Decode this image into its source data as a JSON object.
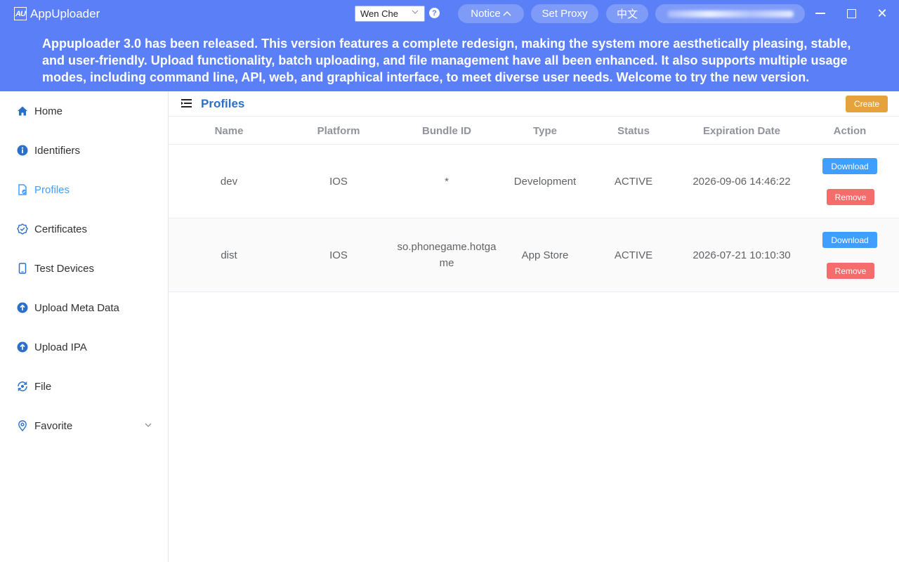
{
  "app": {
    "logo_text": "AU",
    "title": "AppUploader"
  },
  "toolbar": {
    "account": "Wen Che",
    "help": "?",
    "notice": "Notice",
    "set_proxy": "Set Proxy",
    "language": "中文",
    "close_glyph": "✕"
  },
  "announcement": "Appuploader 3.0 has been released. This version features a complete redesign, making the system more aesthetically pleasing, stable, and user-friendly. Upload functionality, batch uploading, and file management have all been enhanced. It also supports multiple usage modes, including command line, API, web, and graphical interface, to meet diverse user needs. Welcome to try the new version.",
  "sidebar": {
    "active": "Profiles",
    "items": [
      {
        "label": "Home",
        "icon": "home-icon"
      },
      {
        "label": "Identifiers",
        "icon": "info-icon"
      },
      {
        "label": "Profiles",
        "icon": "profile-file-icon"
      },
      {
        "label": "Certificates",
        "icon": "certificate-badge-icon"
      },
      {
        "label": "Test Devices",
        "icon": "phone-icon"
      },
      {
        "label": "Upload Meta Data",
        "icon": "upload-circle-icon"
      },
      {
        "label": "Upload IPA",
        "icon": "upload-circle-icon"
      },
      {
        "label": "File",
        "icon": "file-sync-icon"
      },
      {
        "label": "Favorite",
        "icon": "location-pin-icon"
      }
    ]
  },
  "page": {
    "title": "Profiles",
    "create_label": "Create"
  },
  "table": {
    "columns": [
      "Name",
      "Platform",
      "Bundle ID",
      "Type",
      "Status",
      "Expiration Date",
      "Action"
    ],
    "rows": [
      {
        "name": "dev",
        "platform": "IOS",
        "bundle_id": "*",
        "type": "Development",
        "status": "ACTIVE",
        "expiration": "2026-09-06 14:46:22"
      },
      {
        "name": "dist",
        "platform": "IOS",
        "bundle_id": "so.phonegame.hotgame",
        "type": "App Store",
        "status": "ACTIVE",
        "expiration": "2026-07-21 10:10:30"
      }
    ],
    "download_label": "Download",
    "remove_label": "Remove"
  },
  "colors": {
    "brand": "#5b7ff7",
    "active": "#409eff",
    "create": "#e6a23c",
    "download": "#409eff",
    "remove": "#f56c6c"
  }
}
